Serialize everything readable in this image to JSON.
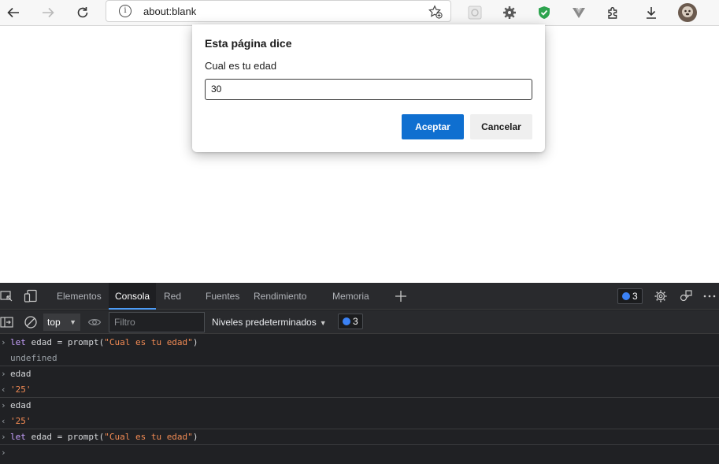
{
  "browser": {
    "url": "about:blank",
    "back_icon": "arrow-left-icon",
    "forward_icon": "arrow-right-icon",
    "reload_icon": "reload-icon"
  },
  "dialog": {
    "title": "Esta página dice",
    "message": "Cual es tu edad",
    "input_value": "30",
    "accept_label": "Aceptar",
    "cancel_label": "Cancelar"
  },
  "devtools": {
    "tabs": [
      "Elementos",
      "Consola",
      "Red",
      "Fuentes",
      "Rendimiento",
      "Memoria"
    ],
    "active_tab": "Consola",
    "issues_count": "3",
    "context": "top",
    "filter_placeholder": "Filtro",
    "levels_label": "Niveles predeterminados",
    "levels_issues_count": "3"
  },
  "console": {
    "lines": [
      {
        "type": "input",
        "kw": "let",
        "rest": " edad =  prompt(",
        "str": "\"Cual es tu edad\"",
        "end": ")"
      },
      {
        "type": "output",
        "text": "undefined"
      },
      {
        "type": "input",
        "text": "edad"
      },
      {
        "type": "output",
        "text": "'25'"
      },
      {
        "type": "input",
        "text": "edad"
      },
      {
        "type": "output",
        "text": "'25'"
      },
      {
        "type": "input",
        "kw": "let",
        "rest": " edad =  prompt(",
        "str": "\"Cual es tu edad\"",
        "end": ")"
      }
    ]
  },
  "colors": {
    "accent": "#0f6fd0",
    "devtools_bg": "#202124",
    "keyword": "#c8a2ff",
    "string": "#f28b54"
  }
}
